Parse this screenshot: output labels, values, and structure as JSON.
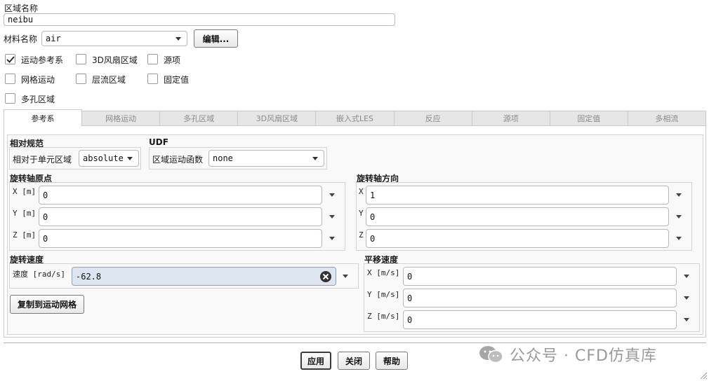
{
  "zone": {
    "name_label": "区域名称",
    "name_value": "neibu"
  },
  "material": {
    "label": "材料名称",
    "value": "air",
    "edit_label": "编辑..."
  },
  "options": [
    {
      "label": "运动参考系",
      "checked": true
    },
    {
      "label": "3D风扇区域",
      "checked": false
    },
    {
      "label": "源项",
      "checked": false
    },
    {
      "label": "网格运动",
      "checked": false
    },
    {
      "label": "层流区域",
      "checked": false
    },
    {
      "label": "固定值",
      "checked": false
    },
    {
      "label": "多孔区域",
      "checked": false
    }
  ],
  "tabs": [
    {
      "label": "参考系",
      "active": true
    },
    {
      "label": "网格运动"
    },
    {
      "label": "多孔区域"
    },
    {
      "label": "3D风扇区域"
    },
    {
      "label": "嵌入式LES"
    },
    {
      "label": "反应"
    },
    {
      "label": "源项"
    },
    {
      "label": "固定值"
    },
    {
      "label": "多相流"
    }
  ],
  "relative": {
    "title": "相对规范",
    "label": "相对于单元区域",
    "value": "absolute"
  },
  "udf": {
    "title": "UDF",
    "label": "区域运动函数",
    "value": "none"
  },
  "axis_origin": {
    "title": "旋转轴原点",
    "rows": [
      {
        "label": "X [m]",
        "value": "0"
      },
      {
        "label": "Y [m]",
        "value": "0"
      },
      {
        "label": "Z [m]",
        "value": "0"
      }
    ]
  },
  "axis_direction": {
    "title": "旋转轴方向",
    "rows": [
      {
        "label": "X",
        "value": "1"
      },
      {
        "label": "Y",
        "value": "0"
      },
      {
        "label": "Z",
        "value": "0"
      }
    ]
  },
  "rot_speed": {
    "title": "旋转速度",
    "label": "速度 [rad/s]",
    "value": "-62.8",
    "copy_label": "复制到运动网格"
  },
  "trans_speed": {
    "title": "平移速度",
    "rows": [
      {
        "label": "X [m/s]",
        "value": "0"
      },
      {
        "label": "Y [m/s]",
        "value": "0"
      },
      {
        "label": "Z [m/s]",
        "value": "0"
      }
    ]
  },
  "buttons": {
    "apply": "应用",
    "close": "关闭",
    "help": "帮助"
  },
  "watermark": "公众号 · CFD仿真库",
  "colors": {
    "accent_field": "#dde6f0",
    "check": "#222222"
  }
}
